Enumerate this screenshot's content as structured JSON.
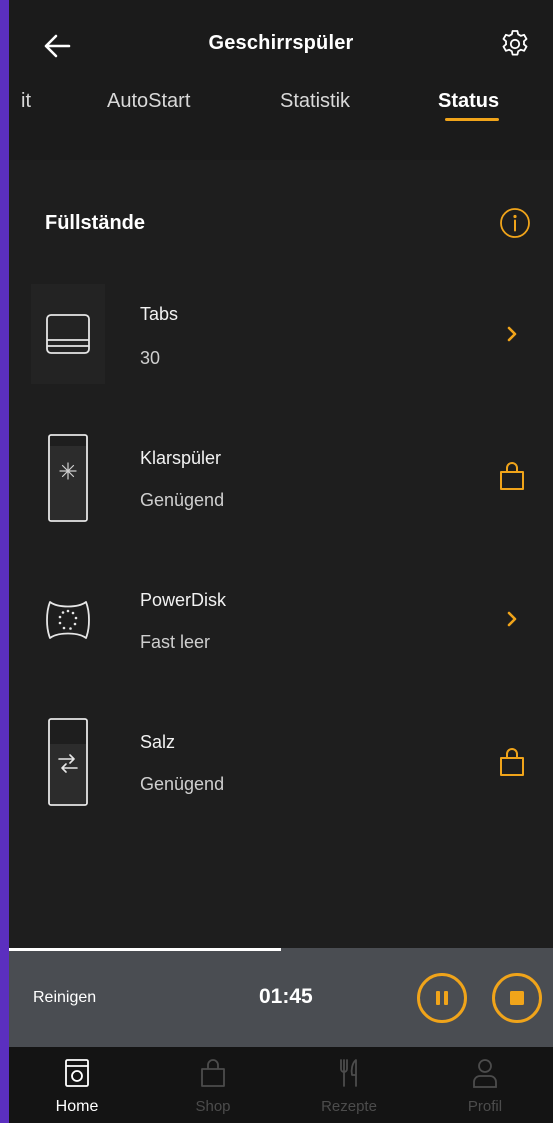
{
  "header": {
    "title": "Geschirrspüler",
    "tabs": [
      {
        "label": "it"
      },
      {
        "label": "AutoStart"
      },
      {
        "label": "Statistik"
      },
      {
        "label": "Status",
        "active": true
      }
    ]
  },
  "section": {
    "title": "Füllstände"
  },
  "items": [
    {
      "name": "Tabs",
      "value": "30",
      "icon": "tabs-icon",
      "action": "chevron-right-icon"
    },
    {
      "name": "Klarspüler",
      "value": "Genügend",
      "icon": "rinse-aid-icon",
      "action": "shopping-bag-icon"
    },
    {
      "name": "PowerDisk",
      "value": "Fast leer",
      "icon": "powerdisk-icon",
      "action": "chevron-right-icon"
    },
    {
      "name": "Salz",
      "value": "Genügend",
      "icon": "salt-icon",
      "action": "shopping-bag-icon"
    }
  ],
  "program": {
    "name": "Reinigen",
    "time_remaining": "01:45",
    "progress": 0.5
  },
  "nav": [
    {
      "label": "Home",
      "icon": "dishwasher-icon",
      "active": true
    },
    {
      "label": "Shop",
      "icon": "shopping-bag-icon",
      "active": false
    },
    {
      "label": "Rezepte",
      "icon": "cutlery-icon",
      "active": false
    },
    {
      "label": "Profil",
      "icon": "user-icon",
      "active": false
    }
  ],
  "colors": {
    "accent": "#f0a41a",
    "background": "#1e1e1e",
    "program_bar": "#4a4d52",
    "nav_inactive": "#4c4c4c",
    "frame": "#5b2fbf"
  }
}
